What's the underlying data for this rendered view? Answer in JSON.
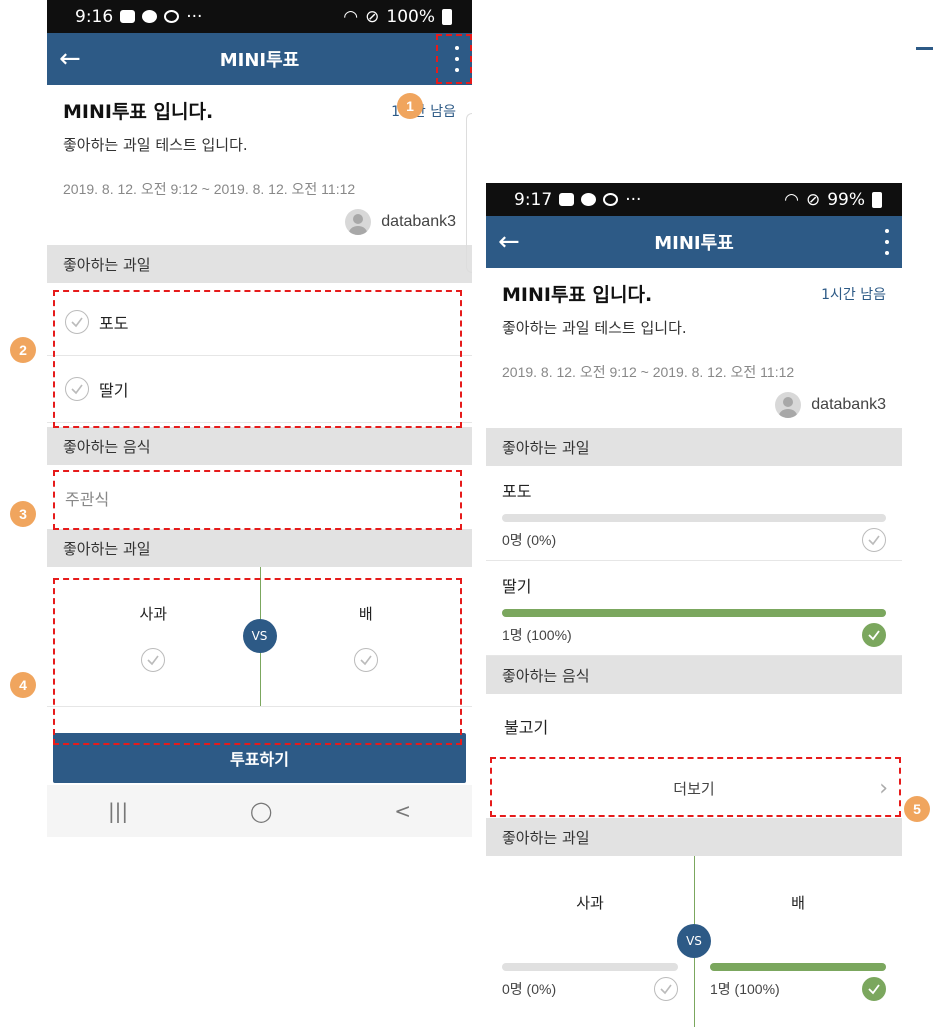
{
  "left": {
    "status": {
      "time": "9:16",
      "battery": "100%"
    },
    "appbar": {
      "title": "MINI투표"
    },
    "header": {
      "title": "MINI투표 입니다.",
      "remaining": "1시간 남음",
      "description": "좋아하는 과일 테스트 입니다.",
      "period": "2019. 8. 12. 오전 9:12 ~ 2019. 8. 12. 오전 11:12",
      "author": "databank3"
    },
    "section1": {
      "title": "좋아하는 과일",
      "options": [
        "포도",
        "딸기"
      ]
    },
    "section2": {
      "title": "좋아하는 음식",
      "placeholder": "주관식"
    },
    "section3": {
      "title": "좋아하는 과일",
      "left": "사과",
      "right": "배",
      "vs": "VS"
    },
    "vote_button": "투표하기",
    "nav": {
      "recent": "|||",
      "home": "◯",
      "back": "<"
    }
  },
  "right": {
    "status": {
      "time": "9:17",
      "battery": "99%"
    },
    "appbar": {
      "title": "MINI투표"
    },
    "header": {
      "title": "MINI투표 입니다.",
      "remaining": "1시간 남음",
      "description": "좋아하는 과일 테스트 입니다.",
      "period": "2019. 8. 12. 오전 9:12 ~ 2019. 8. 12. 오전 11:12",
      "author": "databank3"
    },
    "section1": {
      "title": "좋아하는 과일",
      "results": [
        {
          "label": "포도",
          "count": "0명 (0%)",
          "percent": 0,
          "selected": false
        },
        {
          "label": "딸기",
          "count": "1명 (100%)",
          "percent": 100,
          "selected": true
        }
      ]
    },
    "section2": {
      "title": "좋아하는 음식",
      "answer": "불고기",
      "more": "더보기"
    },
    "section3": {
      "title": "좋아하는 과일",
      "left": {
        "label": "사과",
        "count": "0명 (0%)",
        "percent": 0
      },
      "right": {
        "label": "배",
        "count": "1명 (100%)",
        "percent": 100
      },
      "vs": "VS"
    }
  },
  "badges": [
    "1",
    "2",
    "3",
    "4",
    "5"
  ],
  "colors": {
    "appbar": "#2d5a86",
    "accent": "#7ba75e",
    "highlight": "#e61b1b",
    "badge": "#f0a55e"
  }
}
